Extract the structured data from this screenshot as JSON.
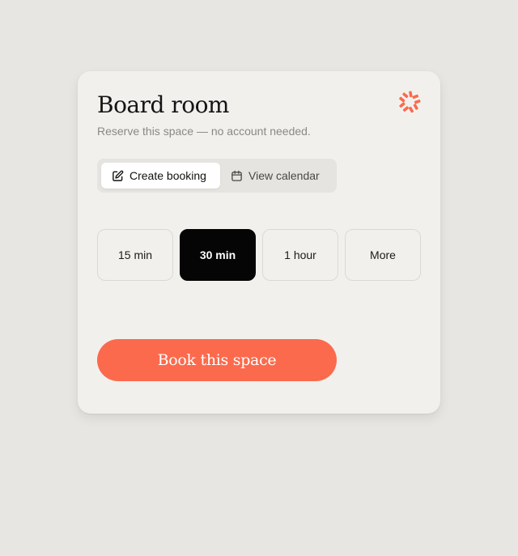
{
  "card": {
    "title": "Board room",
    "subtitle": "Reserve this space — no account needed.",
    "logo_icon": "brand-burst-icon",
    "accent_color": "#fb6a4c"
  },
  "view_switcher": {
    "selected": "Create booking",
    "options": [
      {
        "label": "Create booking",
        "icon": "edit-icon",
        "active": true
      },
      {
        "label": "View calendar",
        "icon": "calendar-icon",
        "active": false
      }
    ]
  },
  "durations": {
    "selected": "30 min",
    "options": [
      {
        "label": "15 min",
        "selected": false
      },
      {
        "label": "30 min",
        "selected": true
      },
      {
        "label": "1 hour",
        "selected": false
      },
      {
        "label": "More",
        "selected": false
      }
    ]
  },
  "actions": {
    "book_label": "Book this space"
  }
}
